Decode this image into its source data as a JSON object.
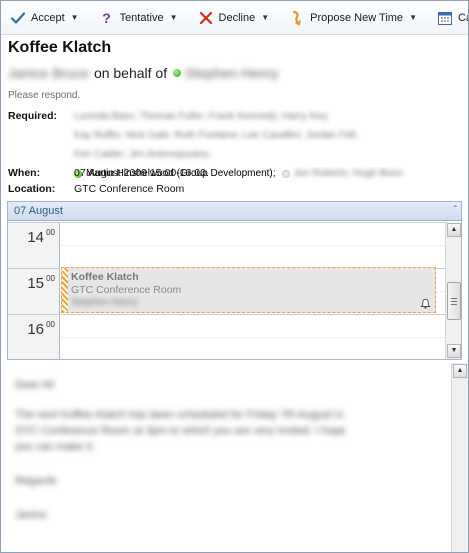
{
  "toolbar": {
    "accept": "Accept",
    "tentative": "Tentative",
    "decline": "Decline",
    "propose": "Propose New Time",
    "calendar": "Calen"
  },
  "meeting": {
    "subject": "Koffee Klatch",
    "sender_name": "Janice Bruce",
    "on_behalf_text": "on behalf of",
    "organizer_name": "Stephen Henry",
    "respond_note": "Please respond.",
    "required_label": "Required:",
    "required_lines": [
      "Lucinda Bass; Thomas Fuller; Frank Kennedy; Harry Key;",
      "Kay Ruffin; Nick Gale; Ruth Fontaine; Lee Cavallini; Jordan Fell;",
      "Kim Calder; Jim Antonopoulos;"
    ],
    "required_known": "Martin Hinshelwood (Group Development);",
    "required_last": "Jon Roberts; Hugh Bonn",
    "when_label": "When:",
    "when_value": "07 August 2009 15:00-16:00.",
    "location_label": "Location:",
    "location_value": "GTC Conference Room"
  },
  "calendar": {
    "day_header": "07 August",
    "hours": [
      {
        "hour": "14",
        "minutes": "00"
      },
      {
        "hour": "15",
        "minutes": "00"
      },
      {
        "hour": "16",
        "minutes": "00"
      }
    ],
    "appointment": {
      "title": "Koffee Klatch",
      "location": "GTC Conference Room",
      "organizer": "Stephen Henry"
    }
  },
  "body_lines": [
    "Dear All",
    "The next Koffee Klatch has been scheduled for Friday 7th August in",
    "GTC Conference Room at 3pm to which you are very invited. I hope",
    "you can make it.",
    "Regards",
    "Janice"
  ],
  "colors": {
    "accept": "#2f6db5",
    "tentative": "#6a3fa0",
    "decline": "#d62a22",
    "propose": "#e09a2c",
    "accent": "#2b5a8a",
    "presence": "#36b823",
    "tentative_bar": "#f6a23b"
  }
}
